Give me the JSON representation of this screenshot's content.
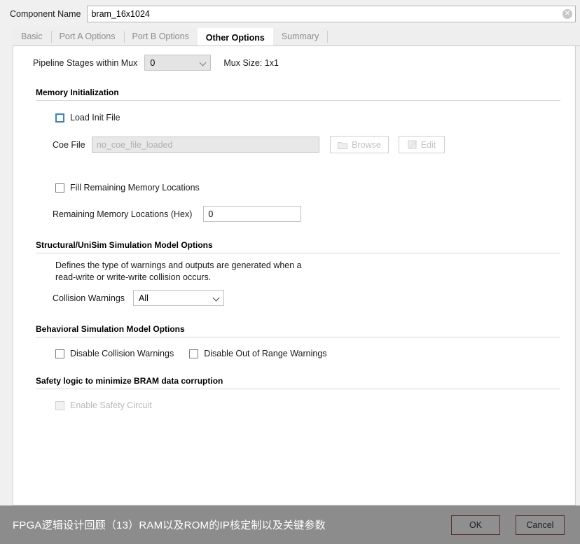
{
  "component": {
    "label": "Component Name",
    "value": "bram_16x1024",
    "clear_icon": "clear-circle-icon",
    "clear_glyph": "✕"
  },
  "tabs": [
    {
      "label": "Basic",
      "active": false
    },
    {
      "label": "Port A Options",
      "active": false
    },
    {
      "label": "Port B Options",
      "active": false
    },
    {
      "label": "Other Options",
      "active": true
    },
    {
      "label": "Summary",
      "active": false
    }
  ],
  "pipeline": {
    "label": "Pipeline Stages within Mux",
    "value": "0",
    "mux_size": "Mux Size: 1x1"
  },
  "memory_init": {
    "title": "Memory Initialization",
    "load_init_file": "Load Init File",
    "coe_file_label": "Coe File",
    "coe_file_value": "no_coe_file_loaded",
    "browse_label": "Browse",
    "edit_label": "Edit",
    "browse_icon": "folder-icon",
    "edit_icon": "pencil-icon",
    "fill_remaining": "Fill Remaining Memory Locations",
    "remaining_label": "Remaining Memory Locations (Hex)",
    "remaining_value": "0"
  },
  "structural": {
    "title": "Structural/UniSim Simulation Model Options",
    "description_line1": "Defines the type of warnings and outputs are generated when a",
    "description_line2": "read-write or write-write collision occurs.",
    "collision_label": "Collision Warnings",
    "collision_value": "All"
  },
  "behavioral": {
    "title": "Behavioral Simulation Model Options",
    "disable_collision": "Disable Collision Warnings",
    "disable_out_of_range": "Disable Out of Range Warnings"
  },
  "safety": {
    "title": "Safety logic to minimize BRAM data corruption",
    "enable_safety_circuit": "Enable Safety Circuit"
  },
  "footer": {
    "watermark": "FPGA逻辑设计回顾（13）RAM以及ROM的IP核定制以及关键参数",
    "ok": "OK",
    "cancel": "Cancel"
  },
  "colors": {
    "focus_blue": "#3a7fd5",
    "footer_band": "#8c8c8c",
    "button_border": "#59322f"
  }
}
